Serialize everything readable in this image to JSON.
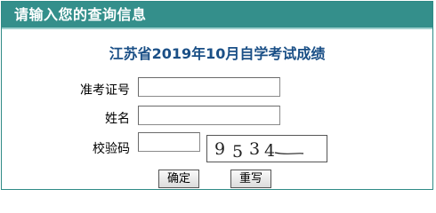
{
  "header": {
    "title": "请输入您的查询信息"
  },
  "form": {
    "title": "江苏省2019年10月自学考试成绩",
    "fields": [
      {
        "label": "准考证号",
        "value": ""
      },
      {
        "label": "姓名",
        "value": ""
      },
      {
        "label": "校验码",
        "value": ""
      }
    ],
    "captcha": {
      "text": "9534"
    }
  },
  "buttons": {
    "confirm": "确定",
    "reset": "重写"
  },
  "colors": {
    "header_bg": "#348f8b",
    "title_color": "#1a4f86"
  }
}
